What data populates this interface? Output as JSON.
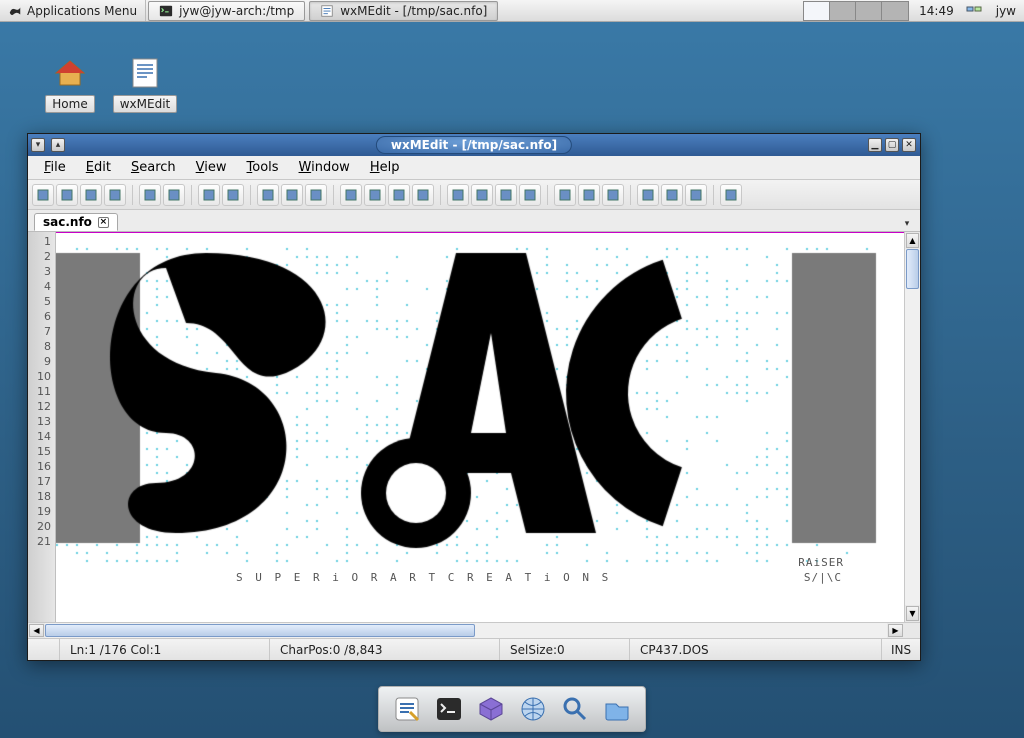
{
  "taskbar": {
    "app_menu_label": "Applications Menu",
    "tasks": [
      {
        "label": "jyw@jyw-arch:/tmp"
      },
      {
        "label": "wxMEdit - [/tmp/sac.nfo]"
      }
    ],
    "clock": "14:49",
    "user": "jyw"
  },
  "desktop_icons": [
    {
      "name": "home-icon",
      "label": "Home"
    },
    {
      "name": "wxmedit-icon",
      "label": "wxMEdit"
    }
  ],
  "window": {
    "title": "wxMEdit - [/tmp/sac.nfo]"
  },
  "menubar": [
    "File",
    "Edit",
    "Search",
    "View",
    "Tools",
    "Window",
    "Help"
  ],
  "toolbar_icons": [
    "new-file-icon",
    "open-file-icon",
    "save-icon",
    "save-all-icon",
    "sep",
    "close-icon",
    "close-all-icon",
    "sep",
    "undo-icon",
    "redo-icon",
    "sep",
    "cut-icon",
    "copy-icon",
    "paste-icon",
    "sep",
    "indent-icon",
    "outdent-icon",
    "comment-icon",
    "uncomment-icon",
    "sep",
    "find-icon",
    "find-next-icon",
    "find-prev-icon",
    "replace-icon",
    "sep",
    "text-mode-icon",
    "column-mode-icon",
    "hex-mode-icon",
    "sep",
    "wrap-icon",
    "show-linenum-icon",
    "show-hex-icon",
    "sep",
    "options-icon"
  ],
  "tab": {
    "label": "sac.nfo"
  },
  "gutter_lines": 21,
  "ascii_art": {
    "credit_top": "RAiSER",
    "credit_bottom": "S/|\\C",
    "caption": "S U P E R i O R   A R T   C R E A T i O N S"
  },
  "statusbar": {
    "line_col": "Ln:1 /176 Col:1",
    "charpos": "CharPos:0 /8,843",
    "selsize": "SelSize:0",
    "encoding": "CP437.DOS",
    "insert_mode": "INS"
  },
  "dock_icons": [
    "editor-app-icon",
    "terminal-app-icon",
    "package-app-icon",
    "browser-app-icon",
    "search-app-icon",
    "files-app-icon"
  ]
}
